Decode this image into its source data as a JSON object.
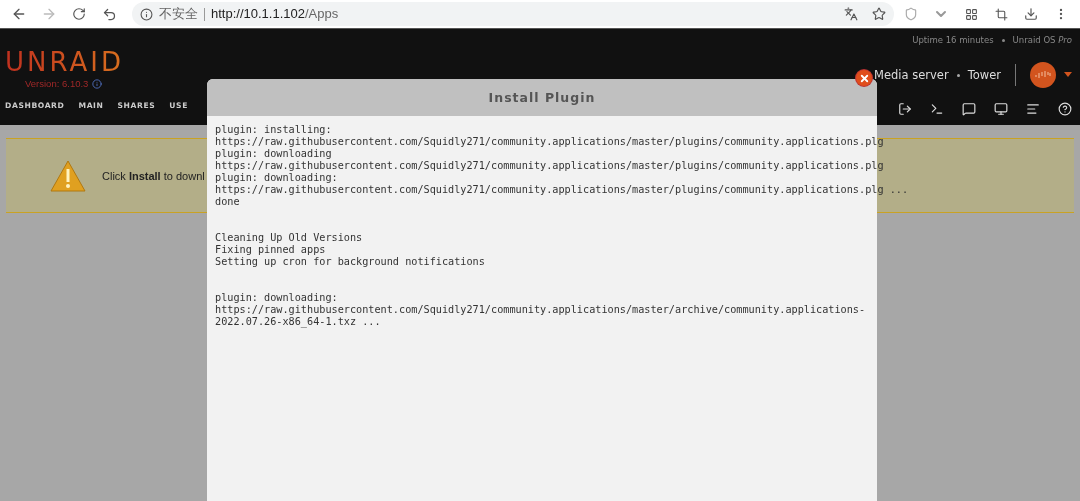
{
  "browser": {
    "security_label": "不安全",
    "url_host": "http://10.1.1.102",
    "url_path": "/Apps"
  },
  "header": {
    "logo": "UNRAID",
    "version": "Version: 6.10.3",
    "uptime": "Uptime 16 minutes",
    "os": "Unraid OS *Pro*",
    "description": "Media server",
    "server_name": "Tower"
  },
  "nav": {
    "items": [
      {
        "label": "DASHBOARD"
      },
      {
        "label": "MAIN"
      },
      {
        "label": "SHARES"
      },
      {
        "label": "USE"
      }
    ]
  },
  "banner": {
    "text": "Click **Install** to downl"
  },
  "modal": {
    "title": "Install Plugin",
    "log_blocks": [
      [
        "plugin: installing:",
        "https://raw.githubusercontent.com/Squidly271/community.applications/master/plugins/community.applications.plg",
        "plugin: downloading",
        "https://raw.githubusercontent.com/Squidly271/community.applications/master/plugins/community.applications.plg",
        "plugin: downloading:",
        "https://raw.githubusercontent.com/Squidly271/community.applications/master/plugins/community.applications.plg ...",
        "done"
      ],
      [
        "Cleaning Up Old Versions",
        "Fixing pinned apps",
        "Setting up cron for background notifications"
      ],
      [
        "plugin: downloading:",
        "https://raw.githubusercontent.com/Squidly271/community.applications/master/archive/community.applications-",
        "2022.07.26-x86_64-1.txz ..."
      ]
    ]
  }
}
